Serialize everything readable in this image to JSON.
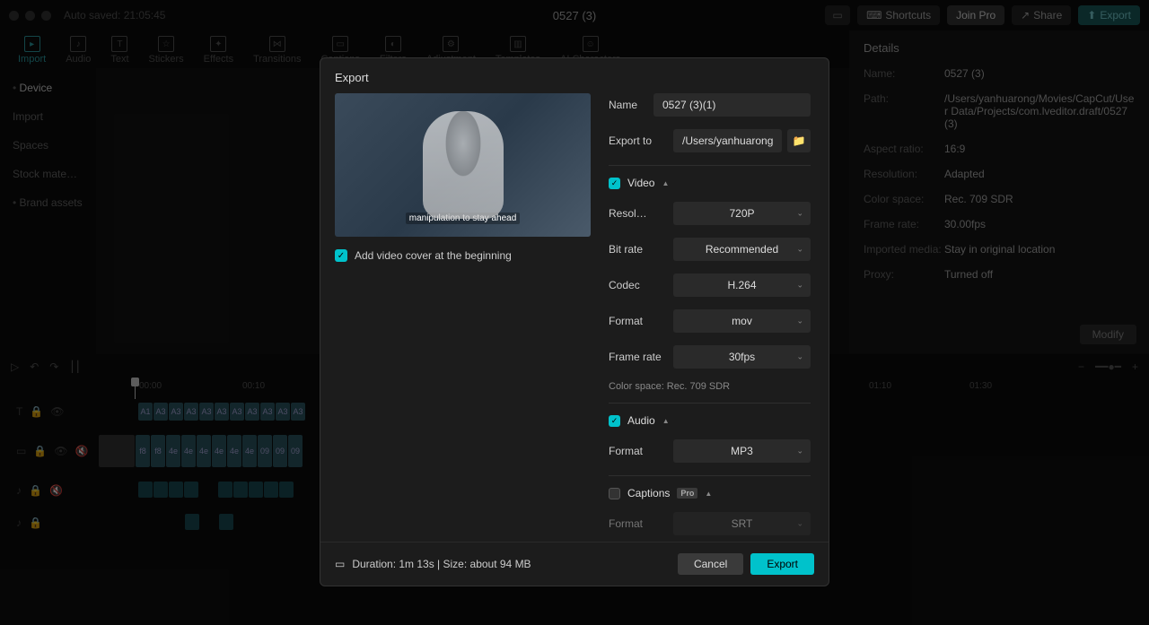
{
  "titlebar": {
    "autosave": "Auto saved: 21:05:45",
    "title": "0527 (3)",
    "shortcuts": "Shortcuts",
    "joinpro": "Join Pro",
    "share": "Share",
    "export": "Export"
  },
  "toolbar": {
    "items": [
      "Import",
      "Audio",
      "Text",
      "Stickers",
      "Effects",
      "Transitions",
      "Captions",
      "Filters",
      "Adjustment",
      "Templates",
      "AI Characters"
    ]
  },
  "sidebar": {
    "items": [
      {
        "label": "Device",
        "bullet": true,
        "active": true
      },
      {
        "label": "Import"
      },
      {
        "label": "Spaces"
      },
      {
        "label": "Stock mate…"
      },
      {
        "label": "Brand assets",
        "bullet": true
      }
    ]
  },
  "details": {
    "title": "Details",
    "rows": [
      {
        "label": "Name:",
        "value": "0527 (3)"
      },
      {
        "label": "Path:",
        "value": "/Users/yanhuarong/Movies/CapCut/User Data/Projects/com.lveditor.draft/0527 (3)"
      },
      {
        "label": "Aspect ratio:",
        "value": "16:9"
      },
      {
        "label": "Resolution:",
        "value": "Adapted"
      },
      {
        "label": "Color space:",
        "value": "Rec. 709 SDR"
      },
      {
        "label": "Frame rate:",
        "value": "30.00fps"
      },
      {
        "label": "Imported media:",
        "value": "Stay in original location"
      },
      {
        "label": "Proxy:",
        "value": "Turned off"
      }
    ],
    "modify": "Modify"
  },
  "timeline": {
    "ticks": [
      "00:00",
      "00:10",
      "01:10",
      "01:30"
    ]
  },
  "modal": {
    "title": "Export",
    "preview_caption": "manipulation to stay ahead",
    "cover_label": "Add video cover at the beginning",
    "name_label": "Name",
    "name_value": "0527 (3)(1)",
    "exportto_label": "Export to",
    "exportto_value": "/Users/yanhuarong/D…",
    "video": {
      "title": "Video",
      "rows": [
        {
          "label": "Resol…",
          "value": "720P"
        },
        {
          "label": "Bit rate",
          "value": "Recommended"
        },
        {
          "label": "Codec",
          "value": "H.264"
        },
        {
          "label": "Format",
          "value": "mov"
        },
        {
          "label": "Frame rate",
          "value": "30fps"
        }
      ],
      "colorspace": "Color space: Rec. 709 SDR"
    },
    "audio": {
      "title": "Audio",
      "format_label": "Format",
      "format_value": "MP3"
    },
    "captions": {
      "title": "Captions",
      "pro": "Pro",
      "format_label": "Format",
      "format_value": "SRT"
    },
    "footer_info": "Duration: 1m 13s | Size: about 94 MB",
    "cancel": "Cancel",
    "export": "Export"
  }
}
